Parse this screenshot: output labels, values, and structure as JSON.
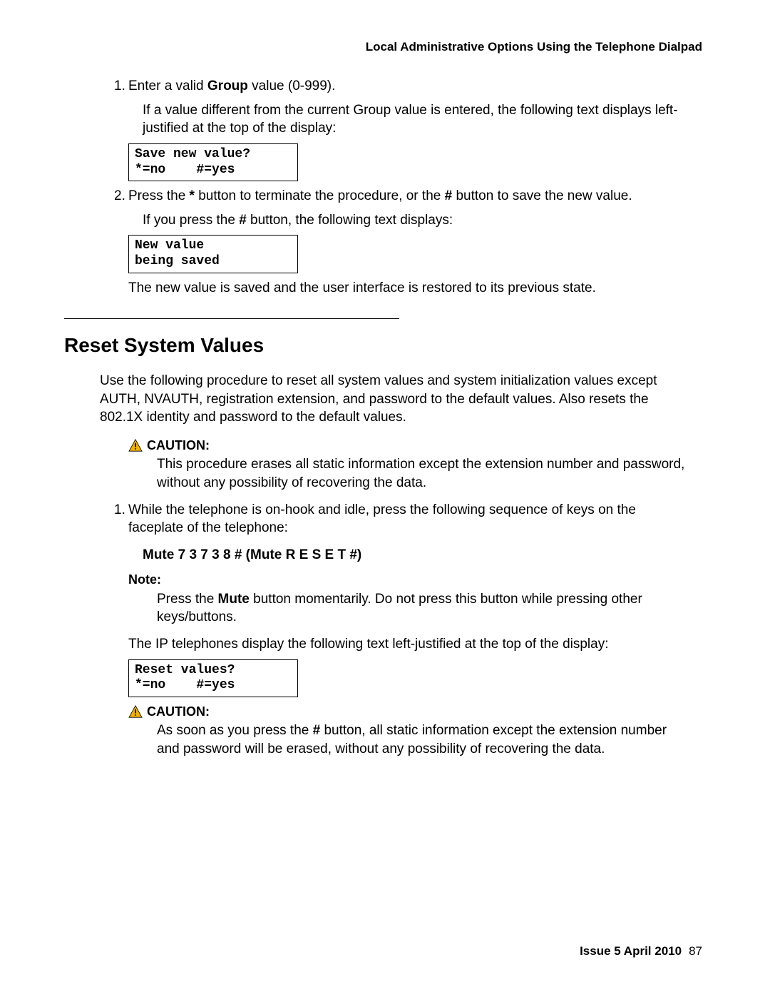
{
  "header": "Local Administrative Options Using the Telephone Dialpad",
  "step1": {
    "num": "1.",
    "text_pre": "Enter a valid ",
    "text_bold": "Group",
    "text_post": " value (0-999).",
    "para": "If a value different from the current Group value is entered, the following text displays left-justified at the top of the display:",
    "code": "Save new value?\n*=no    #=yes"
  },
  "step2": {
    "num": "2.",
    "text_a": "Press the ",
    "text_b": "*",
    "text_c": " button to terminate the procedure, or the ",
    "text_d": "#",
    "text_e": " button to save the new value.",
    "para_a": "If you press the ",
    "para_b": "#",
    "para_c": " button, the following text displays:",
    "code": "New value\nbeing saved",
    "after": "The new value is saved and the user interface is restored to its previous state."
  },
  "section_title": "Reset System Values",
  "section_intro": "Use the following procedure to reset all system values and system initialization values except AUTH, NVAUTH, registration extension, and password to the default values. Also resets the 802.1X identity and password to the default values.",
  "caution1": {
    "label": "CAUTION:",
    "body": "This procedure erases all static information except the extension number and password, without any possibility of recovering the data."
  },
  "rstep1": {
    "num": "1.",
    "text": "While the telephone is on-hook and idle, press the following sequence of keys on the faceplate of the telephone:",
    "mute": "Mute 7 3 7 3 8 # (Mute R E S E T #)"
  },
  "note": {
    "label": "Note:",
    "body_a": "Press the ",
    "body_b": "Mute",
    "body_c": " button momentarily. Do not press this button while pressing other keys/buttons."
  },
  "ip_para": "The IP telephones display the following text left-justified at the top of the display:",
  "reset_code": "Reset values?\n*=no    #=yes",
  "caution2": {
    "label": "CAUTION:",
    "body_a": "As soon as you press the ",
    "body_b": "#",
    "body_c": " button, all static information except the extension number and password will be erased, without any possibility of recovering the data."
  },
  "footer": {
    "issue": "Issue 5   April 2010",
    "page": "87"
  }
}
